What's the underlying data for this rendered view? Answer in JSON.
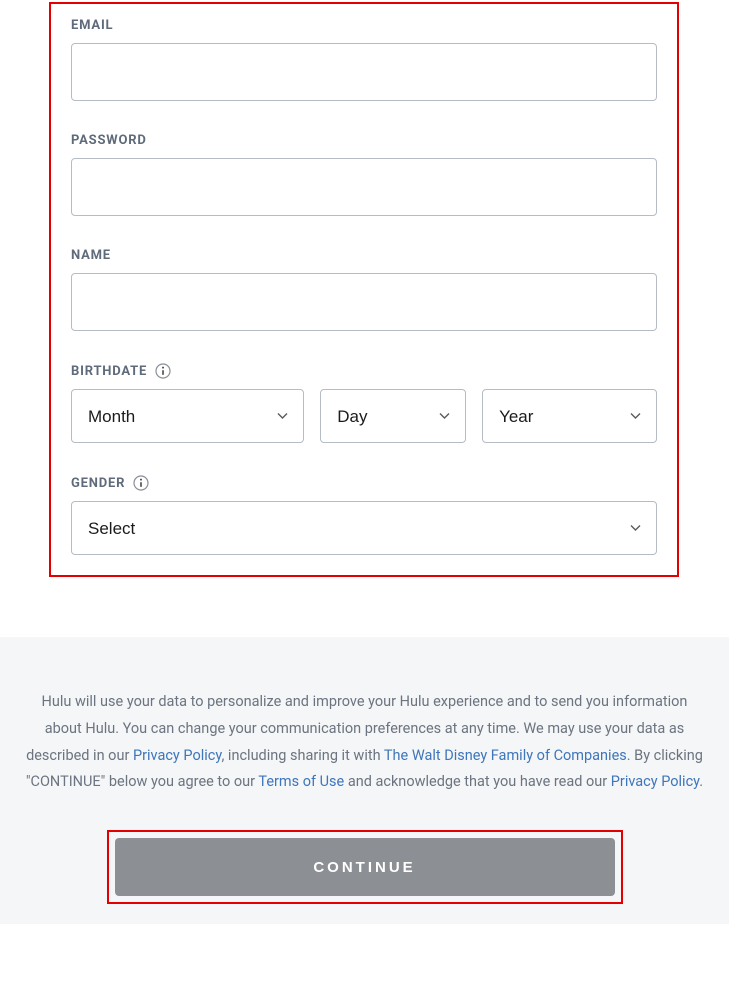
{
  "form": {
    "email": {
      "label": "EMAIL",
      "value": ""
    },
    "password": {
      "label": "PASSWORD",
      "value": ""
    },
    "name": {
      "label": "NAME",
      "value": ""
    },
    "birthdate": {
      "label": "BIRTHDATE",
      "month": "Month",
      "day": "Day",
      "year": "Year"
    },
    "gender": {
      "label": "GENDER",
      "selected": "Select"
    }
  },
  "footer": {
    "legal": {
      "part1": "Hulu will use your data to personalize and improve your Hulu experience and to send you information about Hulu. You can change your communication preferences at any time. We may use your data as described in our ",
      "privacy1": "Privacy Policy",
      "part2": ", including sharing it with ",
      "disney": "The Walt Disney Family of Companies",
      "part3": ". By clicking \"CONTINUE\" below you agree to our ",
      "terms": "Terms of Use",
      "part4": " and acknowledge that you have read our ",
      "privacy2": "Privacy Policy",
      "part5": "."
    },
    "continue_label": "CONTINUE"
  }
}
